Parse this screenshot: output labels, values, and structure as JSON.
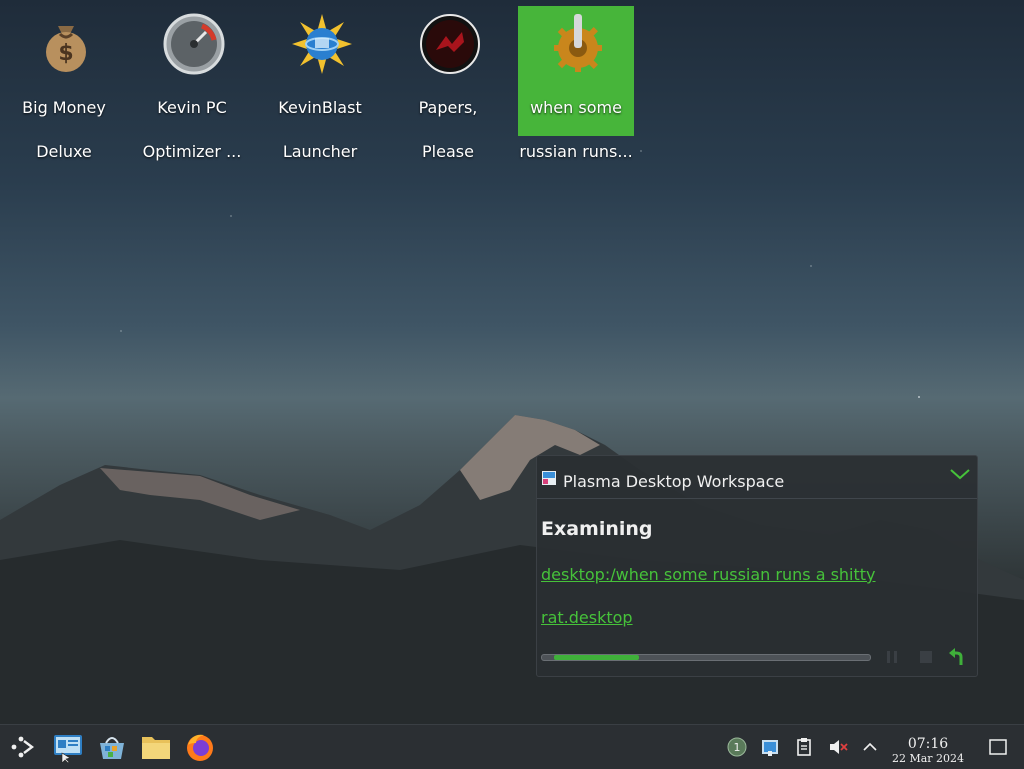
{
  "desktop": {
    "icons": [
      {
        "line1": "Big Money",
        "line2": "Deluxe",
        "icon": "money-bag-icon"
      },
      {
        "line1": "Kevin PC",
        "line2": "Optimizer ...",
        "icon": "speedometer-icon"
      },
      {
        "line1": "KevinBlast",
        "line2": "Launcher",
        "icon": "globe-burst-icon"
      },
      {
        "line1": "Papers,",
        "line2": "Please",
        "icon": "papers-please-icon"
      },
      {
        "line1": "when some",
        "line2": "russian runs...",
        "icon": "gear-icon",
        "selected": true
      }
    ]
  },
  "notification": {
    "app_name": "Plasma Desktop Workspace",
    "title": "Examining",
    "link_line1": "desktop:/when some russian runs a shitty",
    "link_line2": "rat.desktop",
    "progress_fraction": 0.26
  },
  "taskbar": {
    "apps": [
      "application-launcher-icon",
      "system-settings-icon",
      "software-store-icon",
      "file-manager-icon",
      "firefox-icon"
    ],
    "tray": [
      "updates-badge-icon",
      "vault-icon",
      "clipboard-icon",
      "volume-muted-icon",
      "expand-tray-icon",
      "show-desktop-icon"
    ],
    "updates_count": "1",
    "time": "07:16",
    "date": "22 Mar 2024"
  },
  "colors": {
    "accent": "#46c23a",
    "selection": "#47b53a",
    "panel": "#2b2f33"
  }
}
